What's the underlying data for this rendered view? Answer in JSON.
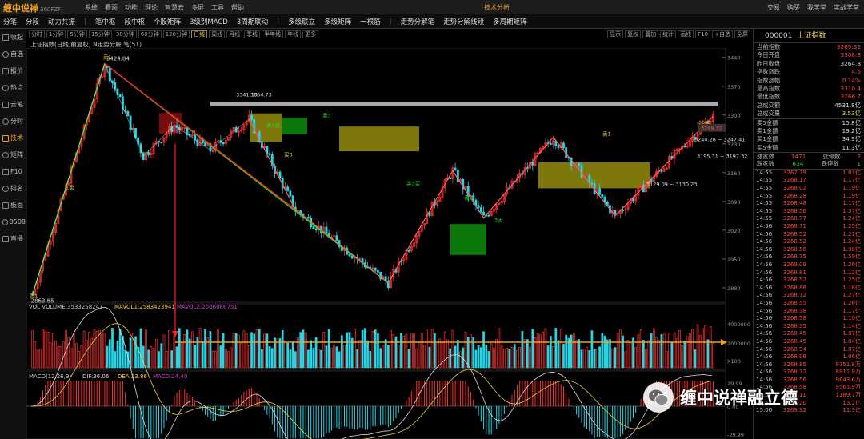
{
  "app": {
    "name": "缠中说禅",
    "sub": "360FZF",
    "window_title": "技术分析"
  },
  "title_menu": [
    "系统",
    "看面",
    "功能",
    "理论",
    "智慧云",
    "多屏",
    "工具",
    "帮助"
  ],
  "title_right": [
    "交易",
    "购买",
    "我学堂",
    "实战学堂"
  ],
  "menu": [
    "分笔",
    "分段",
    "动力共振",
    "|",
    "笔中枢",
    "段中枢",
    "个股矩阵",
    "3级别MACD",
    "3周期联动",
    "|",
    "多级联立",
    "多级矩阵",
    "一根筋",
    "|",
    "走势分解笔",
    "走势分解线段",
    "多周期矩阵"
  ],
  "sidebar": [
    {
      "label": "收起",
      "icon": "collapse-icon"
    },
    {
      "label": "自选",
      "icon": "star-icon"
    },
    {
      "label": "报价",
      "icon": "quote-icon"
    },
    {
      "label": "热点",
      "icon": "fire-icon"
    },
    {
      "label": "云笔",
      "icon": "cloud-icon"
    },
    {
      "label": "分时",
      "icon": "clock-icon"
    },
    {
      "label": "技术",
      "icon": "kline-icon",
      "active": true
    },
    {
      "label": "矩阵",
      "icon": "grid-icon"
    },
    {
      "label": "F10",
      "icon": "f10-icon"
    },
    {
      "label": "排名",
      "icon": "rank-icon"
    },
    {
      "label": "板面",
      "icon": "board-icon"
    },
    {
      "label": "0508",
      "icon": "code-icon"
    },
    {
      "label": "直播",
      "icon": "live-icon"
    }
  ],
  "periods": [
    "分时",
    "1分钟",
    "5分钟",
    "15分钟",
    "30分钟",
    "60分钟",
    "120分钟",
    "日线",
    "周线",
    "月线",
    "季线",
    "半年线",
    "年线",
    "更多"
  ],
  "active_period": "日线",
  "tools": [
    "显示",
    "复权",
    "叠加",
    "统计",
    "画线",
    "F10",
    "+自选",
    "全屏"
  ],
  "caption": "上证指数(日线,前复权) N走势分解 笔(51)",
  "colors": {
    "up": "#ff3030",
    "down": "#22d8e8",
    "green_line": "#22dd22",
    "red_line": "#ff2020",
    "zone_yellow": "#a8a010",
    "zone_green": "#10a010"
  },
  "chart_data": {
    "type": "candlestick",
    "symbol": "上证指数",
    "period": "日线",
    "price_axis": [
      3440,
      3370,
      3300,
      3230,
      3160,
      3090,
      3020,
      2950,
      2880
    ],
    "price_range": [
      2845,
      3455
    ],
    "high_label": "3424.84",
    "low_label": "2863.65",
    "annotations": [
      "3341.10",
      "3354.73",
      "3240.28 ~ 3247.41",
      "3195.31 ~ 3197.32",
      "3129.09 ~ 3130.23"
    ],
    "signals": [
      "买1",
      "买2",
      "买3",
      "卖1",
      "卖2",
      "卖3",
      "3卖",
      "1卖",
      "类2买",
      "类3卖",
      "类3买"
    ],
    "pivots": [
      2863.65,
      3424.84,
      3200,
      3275,
      3215,
      3290,
      3070,
      2892,
      3165,
      3050,
      3246,
      3055,
      3297
    ],
    "current_price_tag": "3269.32",
    "volume": {
      "label": "VOL VOLUME:3533258247",
      "mavol1": "MAVOL1:2583423941",
      "mavol2": "MAVOL2:2506086751",
      "axis": [
        "4000000",
        "2000000",
        "X100"
      ]
    },
    "macd": {
      "label": "MACD(12,26,9)",
      "dif": "DIF:36.06",
      "dea": "DEA:23.86",
      "macd": "MACD:24.40",
      "axis": [
        "29.99",
        "0.00",
        "-29.99"
      ]
    }
  },
  "quote": {
    "code": "000001",
    "name": "上证指数",
    "rows": [
      [
        "当前指数",
        "3269.32",
        "red"
      ],
      [
        "今日开盘",
        "3308.8",
        "red"
      ],
      [
        "昨日收盘",
        "3264.8",
        "wht"
      ],
      [
        "指数涨跌",
        "4.5",
        "red"
      ],
      [
        "指数涨幅",
        "0.14%",
        "red"
      ],
      [
        "最高指数",
        "3310.4",
        "red"
      ],
      [
        "最低指数",
        "3266.7",
        "red"
      ],
      [
        "总成交额",
        "4531.8亿",
        "wht"
      ],
      [
        "总成交量",
        "3.53亿",
        "yel"
      ]
    ],
    "rows2": [
      [
        "卖5金额",
        "15.8亿",
        "wht"
      ],
      [
        "卖1金额",
        "19.2亿",
        "wht"
      ],
      [
        "买1金额",
        "34.9亿",
        "wht"
      ],
      [
        "买5金额",
        "11.3亿",
        "wht"
      ]
    ],
    "counts": [
      [
        "涨家数",
        "1471",
        "张停数",
        "2"
      ],
      [
        "跌家数",
        "634",
        "跌停数",
        "1"
      ]
    ]
  },
  "ticks": [
    [
      "14:55",
      "3267.79",
      "1.01亿"
    ],
    [
      "14:55",
      "3268.17",
      "1.17亿"
    ],
    [
      "14:55",
      "3268.02",
      "1.19亿"
    ],
    [
      "14:55",
      "3268.28",
      "1.19亿"
    ],
    [
      "14:55",
      "3268.48",
      "1.17亿"
    ],
    [
      "14:55",
      "3268.56",
      "1.37亿"
    ],
    [
      "14:55",
      "3268.77",
      "1.24亿"
    ],
    [
      "14:56",
      "3268.71",
      "1.25亿"
    ],
    [
      "14:56",
      "3268.52",
      "1.21亿"
    ],
    [
      "14:56",
      "3268.52",
      "1.24亿"
    ],
    [
      "14:56",
      "3268.58",
      "1.98亿"
    ],
    [
      "14:56",
      "3268.75",
      "1.59亿"
    ],
    [
      "14:56",
      "3269.09",
      "1.26亿"
    ],
    [
      "14:56",
      "3268.81",
      "1.12亿"
    ],
    [
      "14:56",
      "3268.52",
      "1.25亿"
    ],
    [
      "14:56",
      "3268.86",
      "1.18亿"
    ],
    [
      "14:56",
      "3268.72",
      "1.27亿"
    ],
    [
      "14:56",
      "3268.55",
      "1.26亿"
    ],
    [
      "14:56",
      "3268.38",
      "1.17亿"
    ],
    [
      "14:56",
      "3268.58",
      "1.10亿"
    ],
    [
      "14:56",
      "3268.35",
      "1.14亿"
    ],
    [
      "14:56",
      "3268.45",
      "1.07亿"
    ],
    [
      "14:56",
      "3268.45",
      "1.04亿"
    ],
    [
      "14:56",
      "3268.94",
      "1.07亿"
    ],
    [
      "14:56",
      "3268.98",
      "1.06亿"
    ],
    [
      "14:56",
      "3268.85",
      "9751.8万"
    ],
    [
      "14:56",
      "3268.72",
      "8811.8万"
    ],
    [
      "14:56",
      "3268.56",
      "9643.6万"
    ],
    [
      "14:56",
      "3268.58",
      "9561.9万"
    ],
    [
      "14:57",
      "3269.11",
      "1189.7万"
    ],
    [
      "14:57",
      "3269.20",
      "13.2亿"
    ],
    [
      "15:00",
      "3269.32",
      "11.3亿"
    ]
  ],
  "watermark": "缠中说禅融立德"
}
